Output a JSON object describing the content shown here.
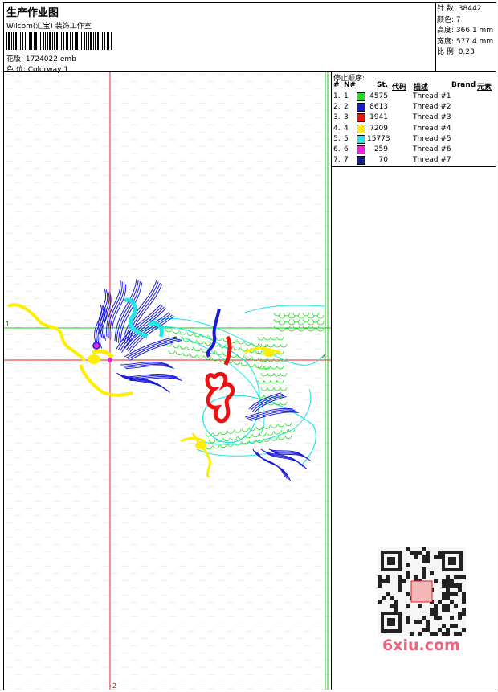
{
  "header": {
    "title": "生产作业图",
    "company": "Wilcom(汇宝) 装饰工作室",
    "design": "花版:   1724022.emb",
    "colorway": "色 位:   Colorway 1"
  },
  "stats": [
    {
      "label": "针 数:",
      "value": "38442"
    },
    {
      "label": "颜色:",
      "value": "7"
    },
    {
      "label": "高度:",
      "value": "366.1 mm"
    },
    {
      "label": "宽度:",
      "value": "577.4 mm"
    },
    {
      "label": "比 例:",
      "value": "0.23"
    }
  ],
  "sequence": {
    "title": "停止顺序:",
    "headers": {
      "num": "#",
      "no": "N#",
      "st": "St.",
      "code": "代码",
      "desc": "描述",
      "brand": "Brand",
      "element": "元素"
    },
    "rows": [
      {
        "num": "1.",
        "no": "1",
        "color": "#22dd22",
        "st": "4575",
        "desc": "Thread #1"
      },
      {
        "num": "2.",
        "no": "2",
        "color": "#1a1ad6",
        "st": "8613",
        "desc": "Thread #2"
      },
      {
        "num": "3.",
        "no": "3",
        "color": "#ee1111",
        "st": "1941",
        "desc": "Thread #3"
      },
      {
        "num": "4.",
        "no": "4",
        "color": "#ffee00",
        "st": "7209",
        "desc": "Thread #4"
      },
      {
        "num": "5.",
        "no": "5",
        "color": "#22e5e5",
        "st": "15773",
        "desc": "Thread #5"
      },
      {
        "num": "6.",
        "no": "6",
        "color": "#ee22dd",
        "st": "259",
        "desc": "Thread #6"
      },
      {
        "num": "7.",
        "no": "7",
        "color": "#112288",
        "st": "70",
        "desc": "Thread #7"
      }
    ]
  },
  "canvas": {
    "marker_top": "1",
    "marker_right": "2",
    "marker_bottom": "2"
  },
  "watermark": {
    "site": "6xiu.com"
  }
}
